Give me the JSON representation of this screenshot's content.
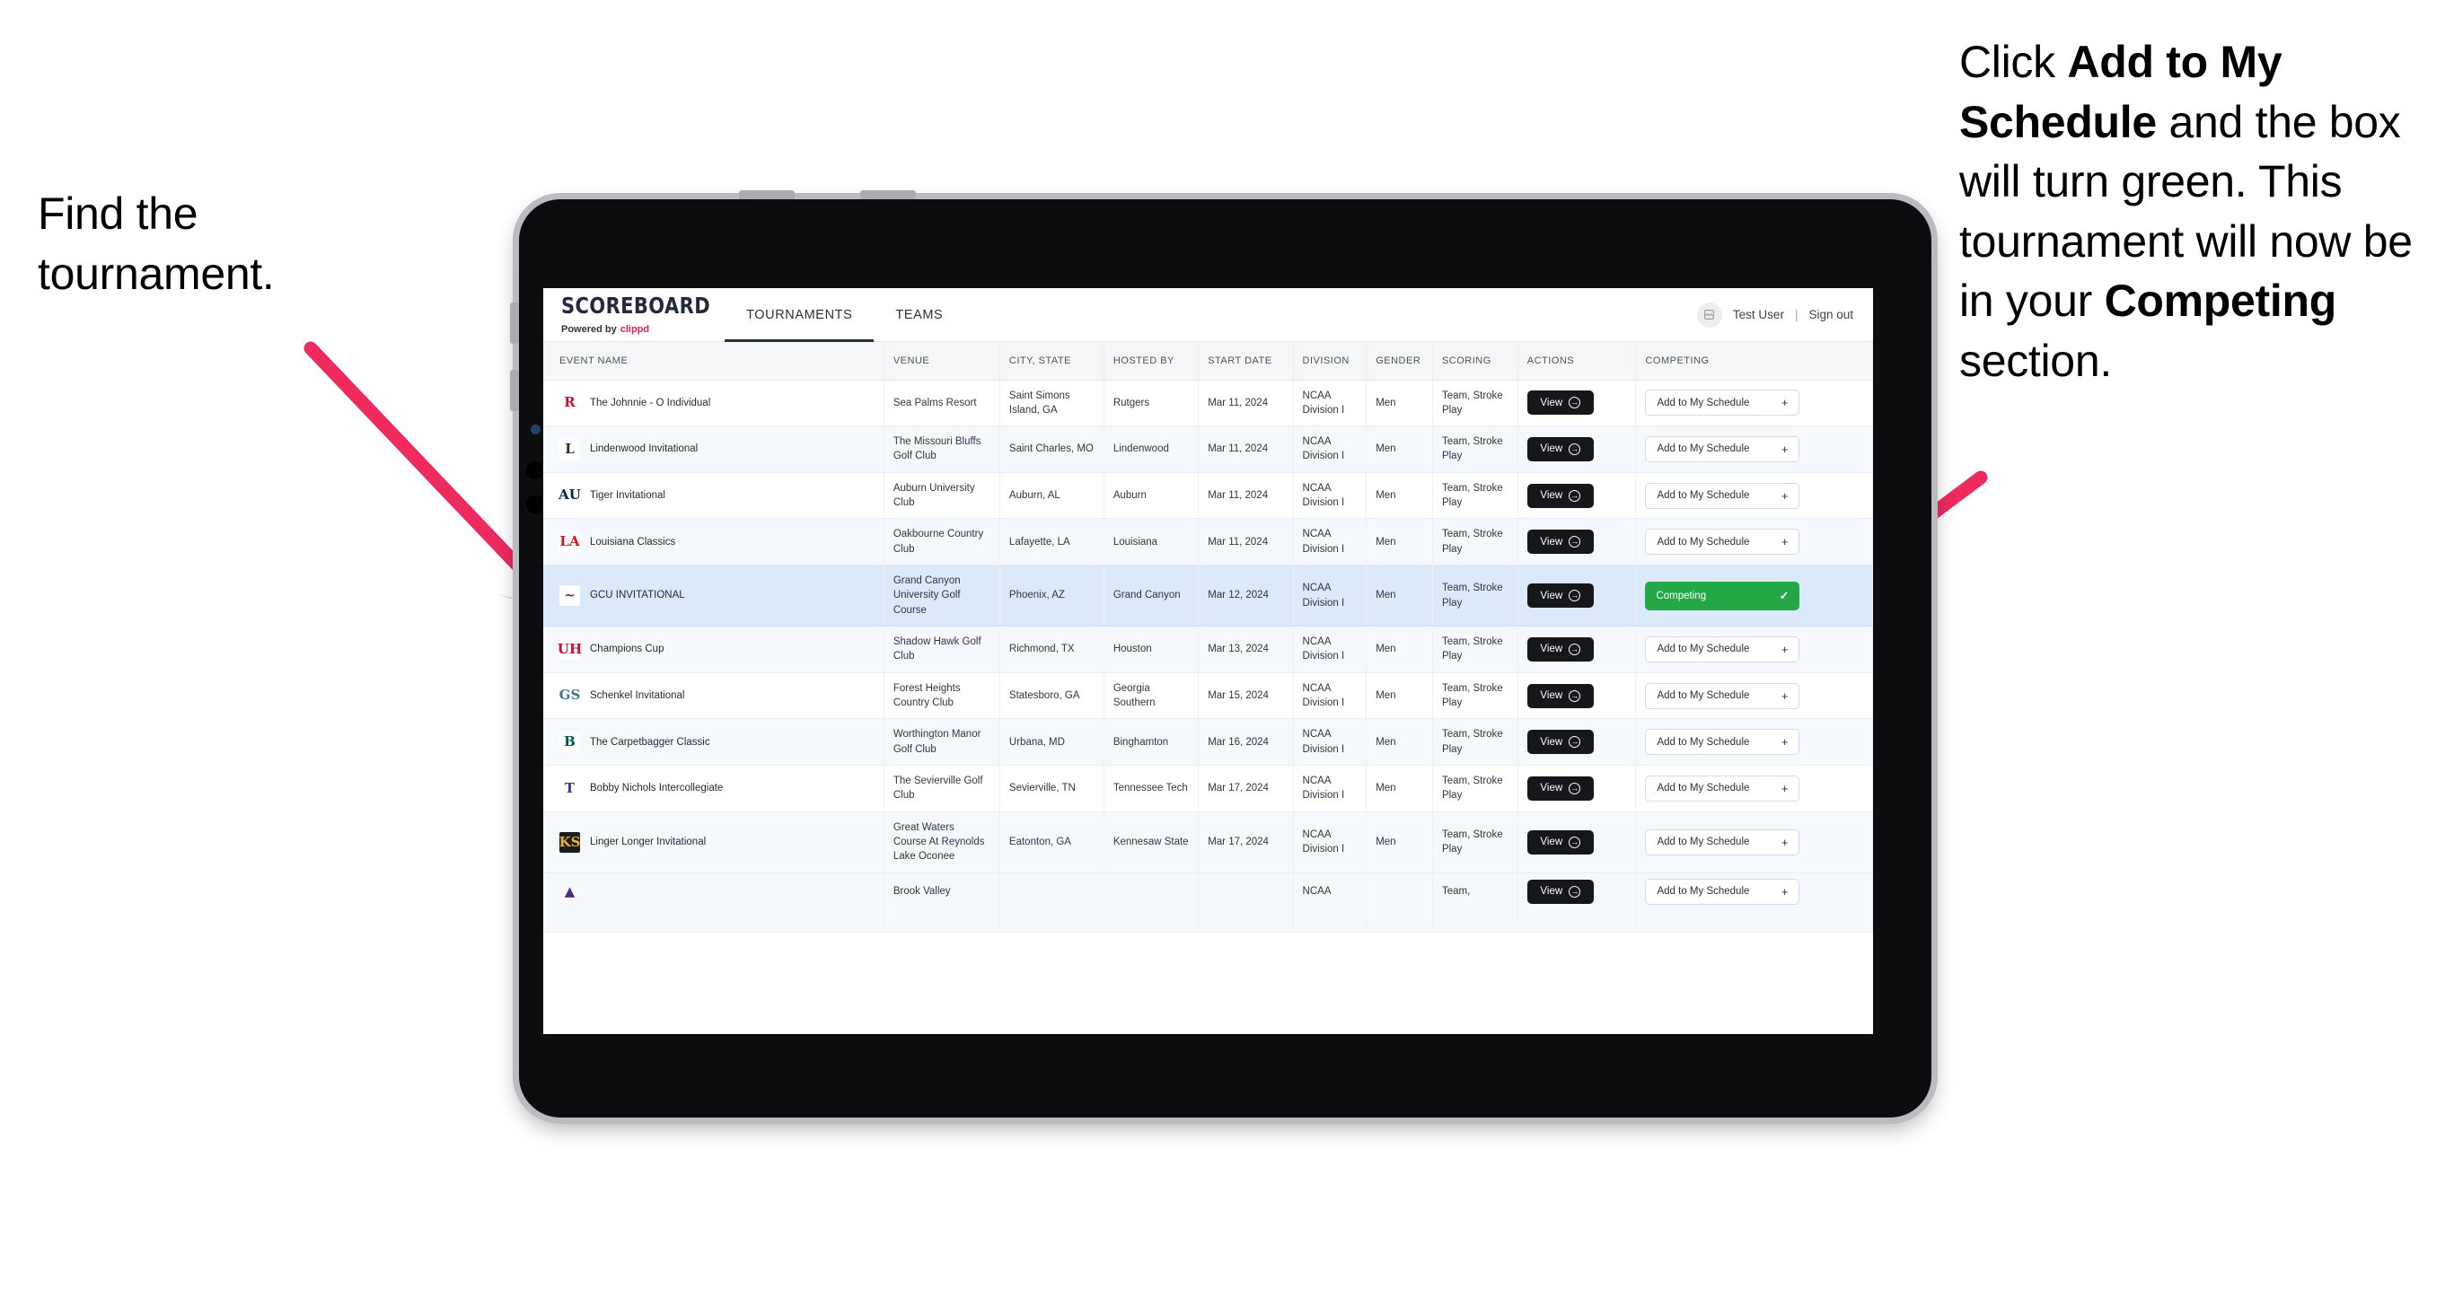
{
  "annotations": {
    "left": {
      "line1": "Find the",
      "line2": "tournament."
    },
    "right": {
      "pre": "Click ",
      "bold1": "Add to My Schedule",
      "mid": " and the box will turn green. This tournament will now be in your ",
      "bold2": "Competing",
      "post": " section."
    },
    "arrow_color": "#ee2a5f"
  },
  "app": {
    "logo": {
      "word": "SCOREBOARD",
      "powered_prefix": "Powered by",
      "brand": "clippd"
    },
    "tabs": [
      {
        "label": "TOURNAMENTS",
        "active": true
      },
      {
        "label": "TEAMS",
        "active": false
      }
    ],
    "user": {
      "name": "Test User",
      "separator": "|",
      "signout": "Sign out",
      "avatar_icon": "user-avatar-icon"
    }
  },
  "table": {
    "columns": [
      "EVENT NAME",
      "VENUE",
      "CITY, STATE",
      "HOSTED BY",
      "START DATE",
      "DIVISION",
      "GENDER",
      "SCORING",
      "ACTIONS",
      "COMPETING"
    ],
    "view_label": "View",
    "add_label": "Add to My Schedule",
    "competing_label": "Competing",
    "rows": [
      {
        "event": "The Johnnie - O Individual",
        "logo_text": "R",
        "logo_fg": "#c8102e",
        "logo_bg": "#ffffff",
        "venue": "Sea Palms Resort",
        "city": "Saint Simons Island, GA",
        "hosted_by": "Rutgers",
        "start_date": "Mar 11, 2024",
        "division": "NCAA Division I",
        "gender": "Men",
        "scoring": "Team, Stroke Play",
        "competing": false
      },
      {
        "event": "Lindenwood Invitational",
        "logo_text": "L",
        "logo_fg": "#2b2b2b",
        "logo_bg": "#ffffff",
        "venue": "The Missouri Bluffs Golf Club",
        "city": "Saint Charles, MO",
        "hosted_by": "Lindenwood",
        "start_date": "Mar 11, 2024",
        "division": "NCAA Division I",
        "gender": "Men",
        "scoring": "Team, Stroke Play",
        "competing": false
      },
      {
        "event": "Tiger Invitational",
        "logo_text": "AU",
        "logo_fg": "#0c2340",
        "logo_bg": "#ffffff",
        "venue": "Auburn University Club",
        "city": "Auburn, AL",
        "hosted_by": "Auburn",
        "start_date": "Mar 11, 2024",
        "division": "NCAA Division I",
        "gender": "Men",
        "scoring": "Team, Stroke Play",
        "competing": false
      },
      {
        "event": "Louisiana Classics",
        "logo_text": "LA",
        "logo_fg": "#ce181e",
        "logo_bg": "#ffffff",
        "venue": "Oakbourne Country Club",
        "city": "Lafayette, LA",
        "hosted_by": "Louisiana",
        "start_date": "Mar 11, 2024",
        "division": "NCAA Division I",
        "gender": "Men",
        "scoring": "Team, Stroke Play",
        "competing": false
      },
      {
        "event": "GCU INVITATIONAL",
        "logo_text": "~",
        "logo_fg": "#522398",
        "logo_bg": "#ffffff",
        "venue": "Grand Canyon University Golf Course",
        "city": "Phoenix, AZ",
        "hosted_by": "Grand Canyon",
        "start_date": "Mar 12, 2024",
        "division": "NCAA Division I",
        "gender": "Men",
        "scoring": "Team, Stroke Play",
        "competing": true
      },
      {
        "event": "Champions Cup",
        "logo_text": "UH",
        "logo_fg": "#c8102e",
        "logo_bg": "#ffffff",
        "venue": "Shadow Hawk Golf Club",
        "city": "Richmond, TX",
        "hosted_by": "Houston",
        "start_date": "Mar 13, 2024",
        "division": "NCAA Division I",
        "gender": "Men",
        "scoring": "Team, Stroke Play",
        "competing": false
      },
      {
        "event": "Schenkel Invitational",
        "logo_text": "GS",
        "logo_fg": "#41748d",
        "logo_bg": "#ffffff",
        "venue": "Forest Heights Country Club",
        "city": "Statesboro, GA",
        "hosted_by": "Georgia Southern",
        "start_date": "Mar 15, 2024",
        "division": "NCAA Division I",
        "gender": "Men",
        "scoring": "Team, Stroke Play",
        "competing": false
      },
      {
        "event": "The Carpetbagger Classic",
        "logo_text": "B",
        "logo_fg": "#00594c",
        "logo_bg": "#ffffff",
        "venue": "Worthington Manor Golf Club",
        "city": "Urbana, MD",
        "hosted_by": "Binghamton",
        "start_date": "Mar 16, 2024",
        "division": "NCAA Division I",
        "gender": "Men",
        "scoring": "Team, Stroke Play",
        "competing": false
      },
      {
        "event": "Bobby Nichols Intercollegiate",
        "logo_text": "T",
        "logo_fg": "#4e2a84",
        "logo_bg": "#ffffff",
        "venue": "The Sevierville Golf Club",
        "city": "Sevierville, TN",
        "hosted_by": "Tennessee Tech",
        "start_date": "Mar 17, 2024",
        "division": "NCAA Division I",
        "gender": "Men",
        "scoring": "Team, Stroke Play",
        "competing": false
      },
      {
        "event": "Linger Longer Invitational",
        "logo_text": "KS",
        "logo_fg": "#f0b323",
        "logo_bg": "#1c1c1c",
        "venue": "Great Waters Course At Reynolds Lake Oconee",
        "city": "Eatonton, GA",
        "hosted_by": "Kennesaw State",
        "start_date": "Mar 17, 2024",
        "division": "NCAA Division I",
        "gender": "Men",
        "scoring": "Team, Stroke Play",
        "competing": false
      }
    ],
    "clipped_row": {
      "event": "",
      "venue": "Brook Valley",
      "city": "",
      "hosted_by": "",
      "start_date": "",
      "division": "NCAA",
      "gender": "",
      "scoring": "Team,"
    }
  }
}
